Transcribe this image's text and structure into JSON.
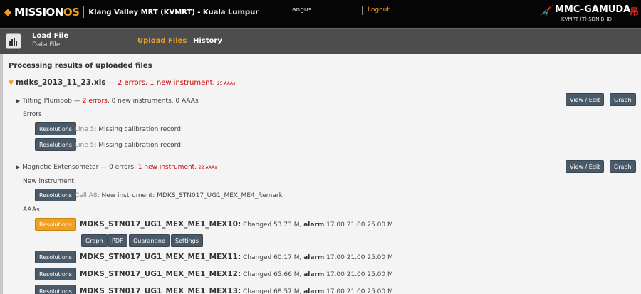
{
  "header": {
    "brand_main": "MISSION",
    "brand_accent": "OS",
    "project_name": "Klang Valley MRT (KVMRT) - Kuala Lumpur",
    "user": "angus",
    "logout_label": "Logout",
    "logo_name": "MMC-GAMUDA",
    "logo_hanzi": "吊",
    "logo_sub": "KVMRT (T) SDN BHD"
  },
  "subnav": {
    "title": "Load File",
    "subtitle": "Data File",
    "tabs": [
      {
        "label": "Upload Files",
        "active": true
      },
      {
        "label": "History",
        "active": false
      }
    ]
  },
  "main": {
    "heading": "Processing results of uploaded files",
    "file": {
      "name": "mdks_2013_11_23.xls",
      "sep": " — ",
      "errors": "2 errors",
      "comma": ", ",
      "new_instruments": "1 new instrument",
      "aaas": "25 AAAs"
    },
    "instruments": [
      {
        "name": "Tilting Plumbob",
        "sep": " — ",
        "errors": "2 errors",
        "rest": ", 0 new instruments, 0 AAAs",
        "view_edit_label": "View / Edit",
        "graph_label": "Graph",
        "section_label": "Errors",
        "resolutions": [
          {
            "button": "Resolutions",
            "loc": "Line 5",
            "msg": ": Missing calibration record:"
          },
          {
            "button": "Resolutions",
            "loc": "Line 5",
            "msg": ": Missing calibration record:"
          }
        ]
      },
      {
        "name": "Magnetic Extensometer",
        "sep": " — 0 errors, ",
        "new_instruments": "1 new instrument",
        "comma": ", ",
        "aaas": "22 AAAs",
        "view_edit_label": "View / Edit",
        "graph_label": "Graph",
        "new_instrument_label": "New instrument",
        "new_instrument": {
          "button": "Resolutions",
          "loc": "Cell A8",
          "msg": ": New instrument: MDKS_STN017_UG1_MEX_ME4_Remark"
        },
        "aaas_label": "AAAs",
        "aaa_items": [
          {
            "button": "Resolutions",
            "name": "MDKS_STN017_UG1_MEX_ME1_MEX10:",
            "changed": " Changed 53.73 M, ",
            "alarm_label": "alarm",
            "alarm_values": " 17.00 21.00 25.00 M"
          },
          {
            "button": "Resolutions",
            "name": "MDKS_STN017_UG1_MEX_ME1_MEX11:",
            "changed": " Changed 60.17 M, ",
            "alarm_label": "alarm",
            "alarm_values": " 17.00 21.00 25.00 M"
          },
          {
            "button": "Resolutions",
            "name": "MDKS_STN017_UG1_MEX_ME1_MEX12:",
            "changed": " Changed 65.66 M, ",
            "alarm_label": "alarm",
            "alarm_values": " 17.00 21.00 25.00 M"
          },
          {
            "button": "Resolutions",
            "name": "MDKS_STN017_UG1_MEX_ME1_MEX13:",
            "changed": " Changed 68.57 M, ",
            "alarm_label": "alarm",
            "alarm_values": " 17.00 21.00 25.00 M"
          }
        ],
        "aaa_actions": [
          "Graph",
          "PDF",
          "Quarantine",
          "Settings"
        ]
      }
    ]
  },
  "colors": {
    "accent": "#f0a020",
    "error_red": "#d00000",
    "button_bg": "#4a5a68",
    "topbar_bg": "#050505",
    "subnav_bg": "#4d4d4d"
  }
}
